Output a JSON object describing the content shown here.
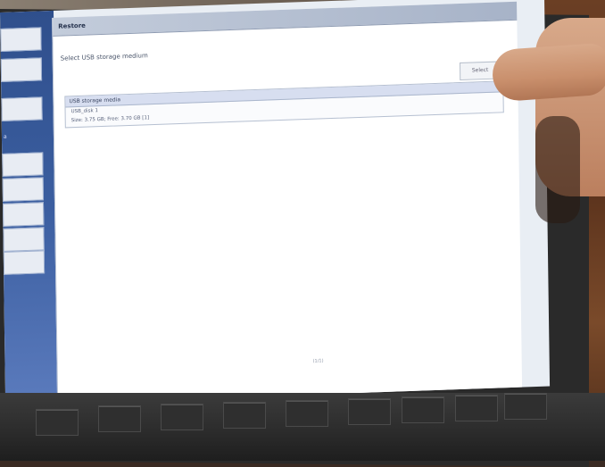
{
  "dialog": {
    "title": "Restore",
    "prompt": "Select USB storage medium",
    "select_button": "Select",
    "table": {
      "header": "USB storage media",
      "rows": [
        "USB_disk 1",
        "Size: 3.75 GB; Free: 3.70 GB [1]"
      ]
    },
    "footer_text": "(1/1)"
  },
  "sidebar": {
    "items": [
      "",
      "",
      "",
      "",
      "",
      "",
      "",
      "",
      ""
    ],
    "note": "a"
  },
  "colors": {
    "sidebar_blue": "#3b5ea0",
    "header_gray": "#c3ccdb",
    "table_header": "#d7def0"
  }
}
